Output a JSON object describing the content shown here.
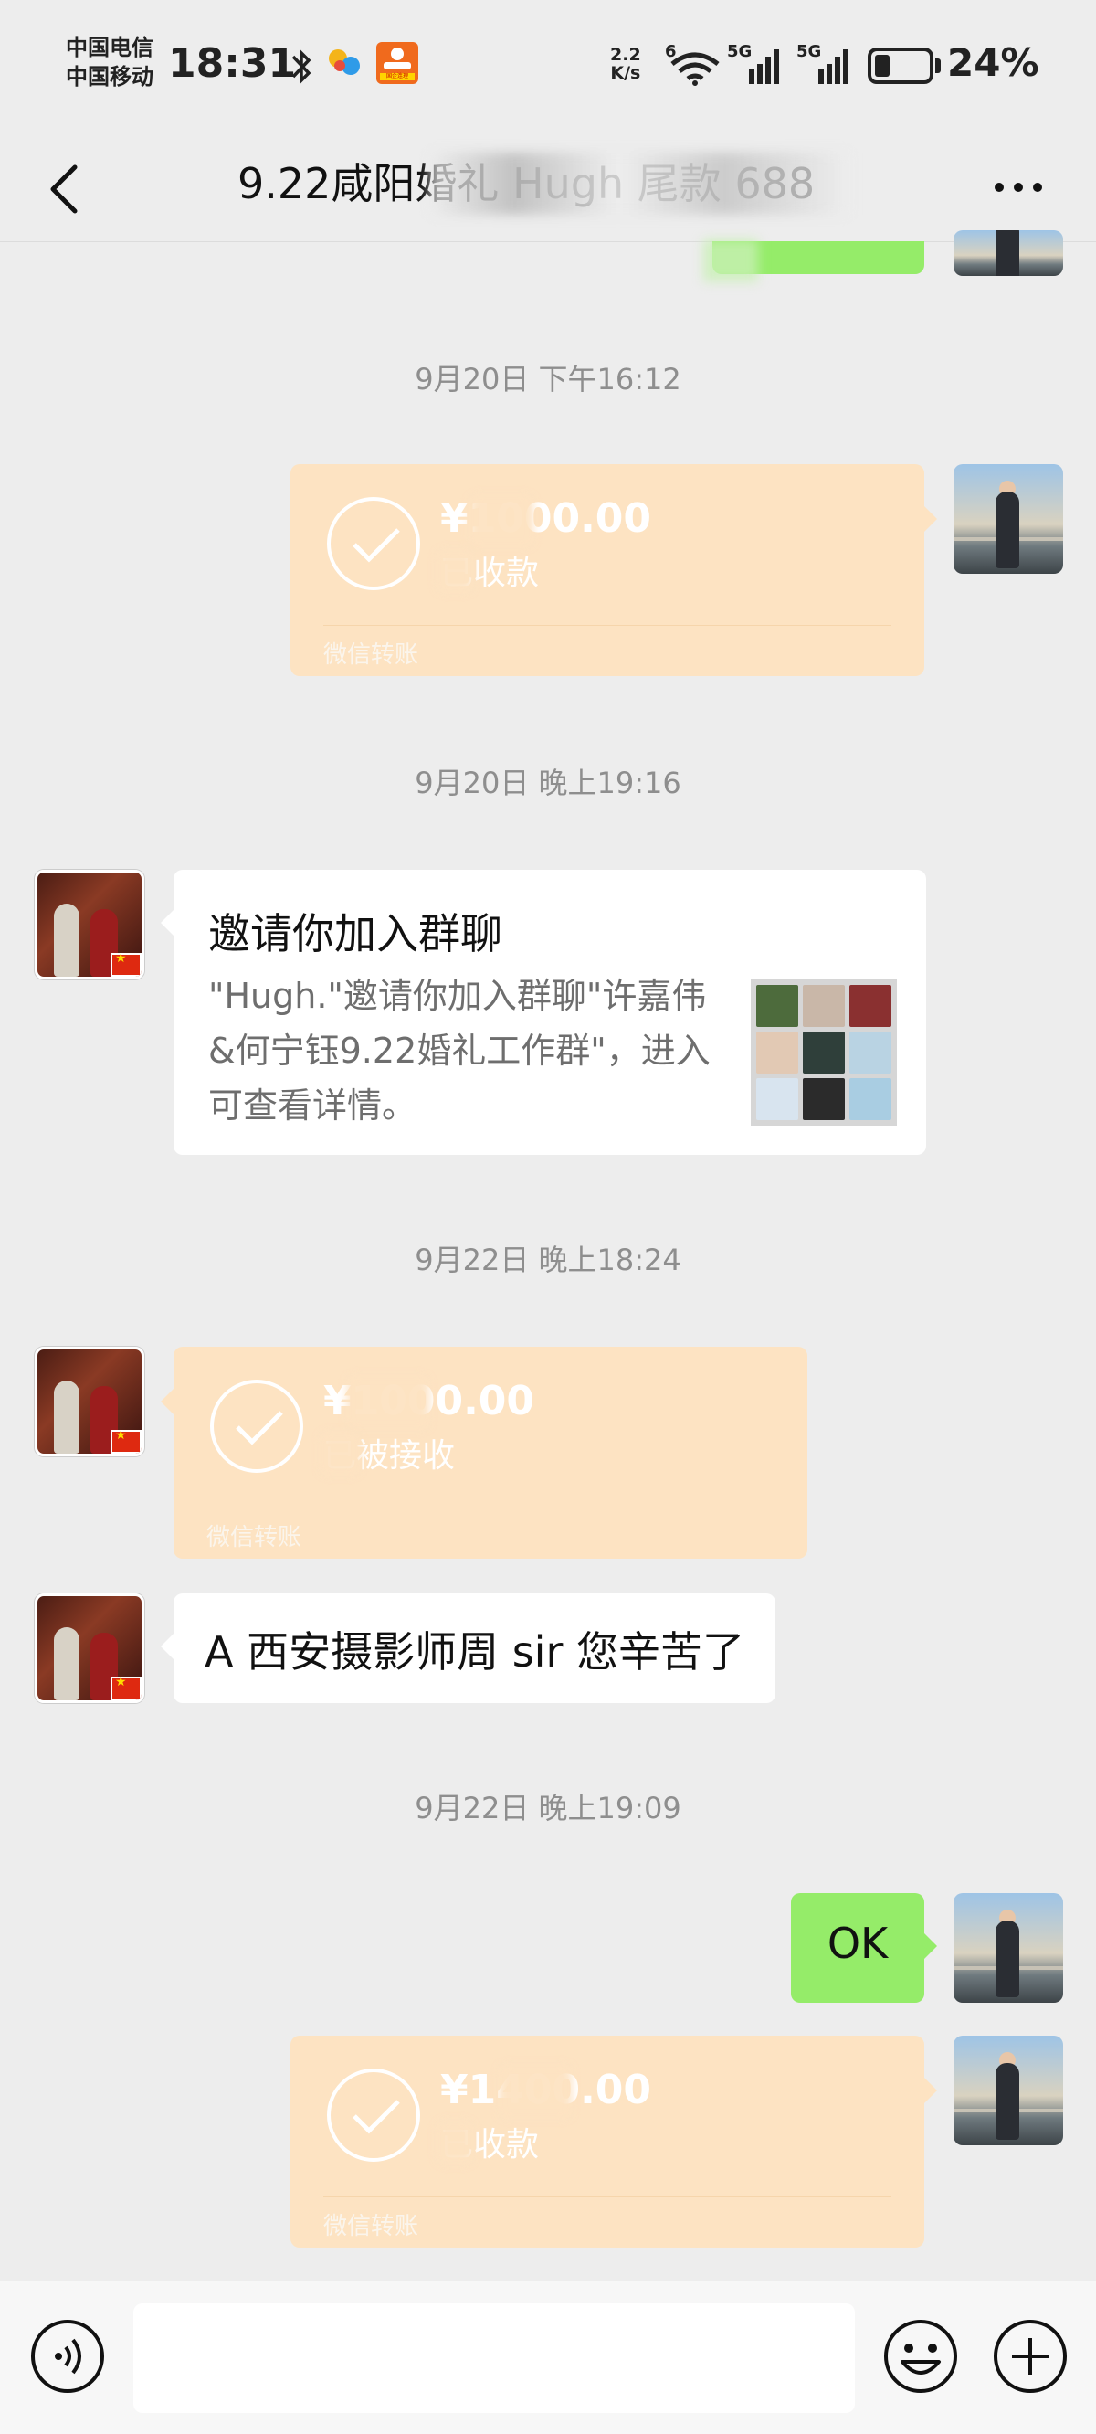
{
  "status_bar": {
    "carrier_1": "中国电信",
    "carrier_2": "中国移动",
    "time": "18:31",
    "net_speed_value": "2.2",
    "net_speed_unit": "K/s",
    "wifi_badge": "6",
    "sim1_badge": "5G",
    "sim2_badge": "5G",
    "battery": "24%",
    "app_icon_label": "国企连理"
  },
  "nav": {
    "title": "9.22咸阳婚礼 Hugh 尾款 688"
  },
  "messages": {
    "ts1": "9月20日 下午16:12",
    "transfer1": {
      "amount": "¥1000.00",
      "status": "已收款",
      "caption": "微信转账"
    },
    "ts2": "9月20日 晚上19:16",
    "invite": {
      "title": "邀请你加入群聊",
      "desc": "\"Hugh.\"邀请你加入群聊\"许嘉伟&何宁钰9.22婚礼工作群\"，进入可查看详情。"
    },
    "ts3": "9月22日 晚上18:24",
    "transfer2": {
      "amount": "¥1000.00",
      "status": "已被接收",
      "caption": "微信转账"
    },
    "text1": "A 西安摄影师周 sir  您辛苦了",
    "ts4": "9月22日 晚上19:09",
    "text2": "OK",
    "transfer3": {
      "amount": "¥1400.00",
      "status": "已收款",
      "caption": "微信转账"
    }
  },
  "colors": {
    "transfer_bg": "#fde3c2",
    "self_bubble": "#95ec69",
    "chat_bg": "#ededed"
  },
  "icons": [
    "back-icon",
    "more-icon",
    "check-icon",
    "voice-icon",
    "emoji-icon",
    "add-icon",
    "bluetooth-icon",
    "wifi-icon",
    "signal-icon",
    "battery-icon"
  ]
}
